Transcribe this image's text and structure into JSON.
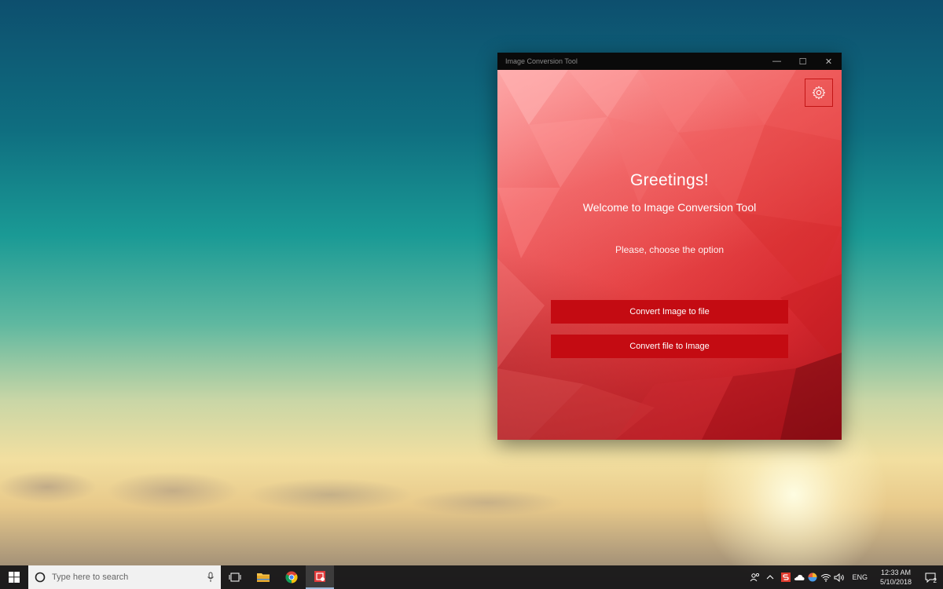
{
  "window": {
    "title": "Image Conversion Tool",
    "minimize_glyph": "—",
    "maximize_glyph": "☐",
    "close_glyph": "✕"
  },
  "main": {
    "greeting": "Greetings!",
    "welcome": "Welcome to Image Conversion Tool",
    "prompt": "Please, choose the option",
    "button_image_to_file": "Convert Image to file",
    "button_file_to_image": "Convert file to Image",
    "settings_icon": "gear-icon"
  },
  "taskbar": {
    "search_placeholder": "Type here to search",
    "pinned": [
      "task-view-icon",
      "file-explorer-icon",
      "chrome-icon",
      "image-conversion-tool-icon"
    ],
    "tray": {
      "language": "ENG",
      "time": "12:33 AM",
      "date": "5/10/2018",
      "notification_count": "2"
    }
  },
  "colors": {
    "accent_button": "#c40b12",
    "titlebar": "#0a0a0a"
  }
}
